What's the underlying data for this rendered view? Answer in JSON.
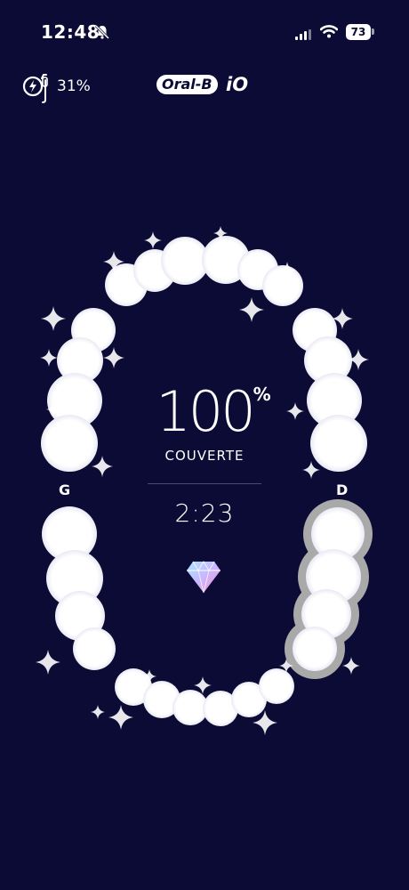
{
  "status_bar": {
    "time": "12:48",
    "battery": "73",
    "icons": [
      "bell-muted-icon",
      "signal-icon",
      "wifi-icon",
      "battery-icon"
    ]
  },
  "header": {
    "brush_battery": "31%",
    "brand": "Oral-B",
    "model": "iO",
    "icons": [
      "toothbrush-charge-icon"
    ]
  },
  "mouth": {
    "left_label": "G",
    "right_label": "D"
  },
  "session": {
    "coverage_value": "100",
    "coverage_unit": "%",
    "coverage_label": "COUVERTE",
    "timer": "2:23",
    "reward_icon": "diamond-icon"
  },
  "colors": {
    "background": "#0b0b35",
    "tooth": "#ffffff",
    "active_outline": "#a9a9a9"
  }
}
